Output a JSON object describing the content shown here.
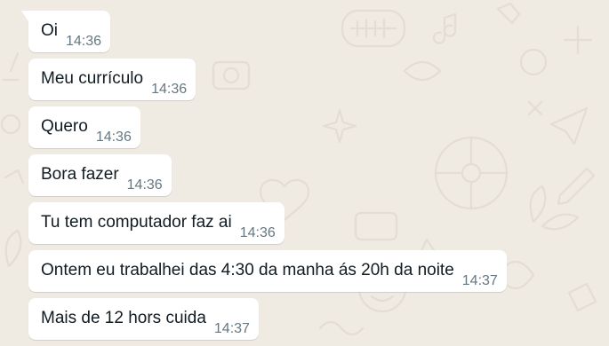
{
  "chat": {
    "messages": [
      {
        "text": "Oi",
        "time": "14:36"
      },
      {
        "text": "Meu currículo",
        "time": "14:36"
      },
      {
        "text": "Quero",
        "time": "14:36"
      },
      {
        "text": "Bora fazer",
        "time": "14:36"
      },
      {
        "text": "Tu tem computador faz ai",
        "time": "14:36"
      },
      {
        "text": "Ontem eu trabalhei das 4:30 da manha ás 20h da noite",
        "time": "14:37"
      },
      {
        "text": "Mais de 12 hors cuida",
        "time": "14:37"
      }
    ]
  },
  "colors": {
    "wallpaper": "#efeae2",
    "bubble": "#ffffff",
    "text": "#111b21",
    "timestamp": "#667781"
  }
}
